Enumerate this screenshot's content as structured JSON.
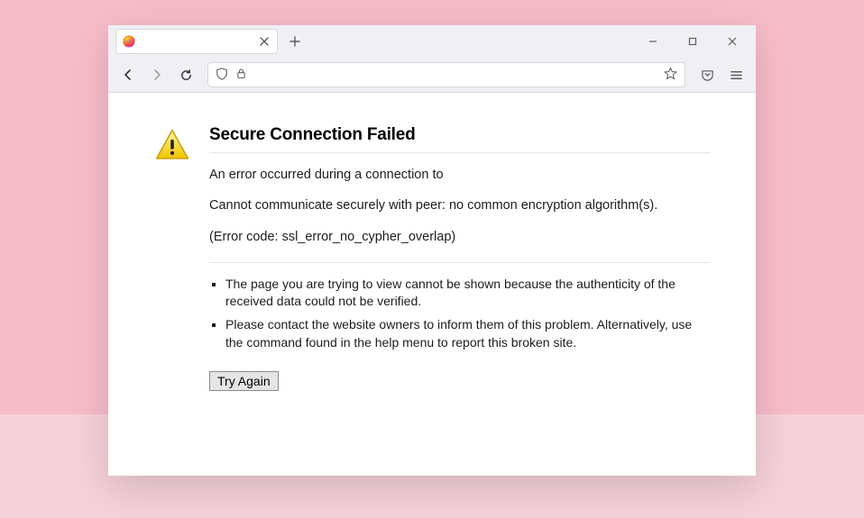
{
  "tabs": {
    "main_label": "",
    "favicon_name": "firefox-logo"
  },
  "error": {
    "title": "Secure Connection Failed",
    "line1": "An error occurred during a connection to",
    "line2": "Cannot communicate securely with peer: no common encryption algorithm(s).",
    "code": "(Error code: ssl_error_no_cypher_overlap)",
    "bullet1": "The page you are trying to view cannot be shown because the authenticity of the received data could not be verified.",
    "bullet2": "Please contact the website owners to inform them of this problem. Alternatively, use the command found in the help menu to report this broken site.",
    "retry_label": "Try Again"
  }
}
